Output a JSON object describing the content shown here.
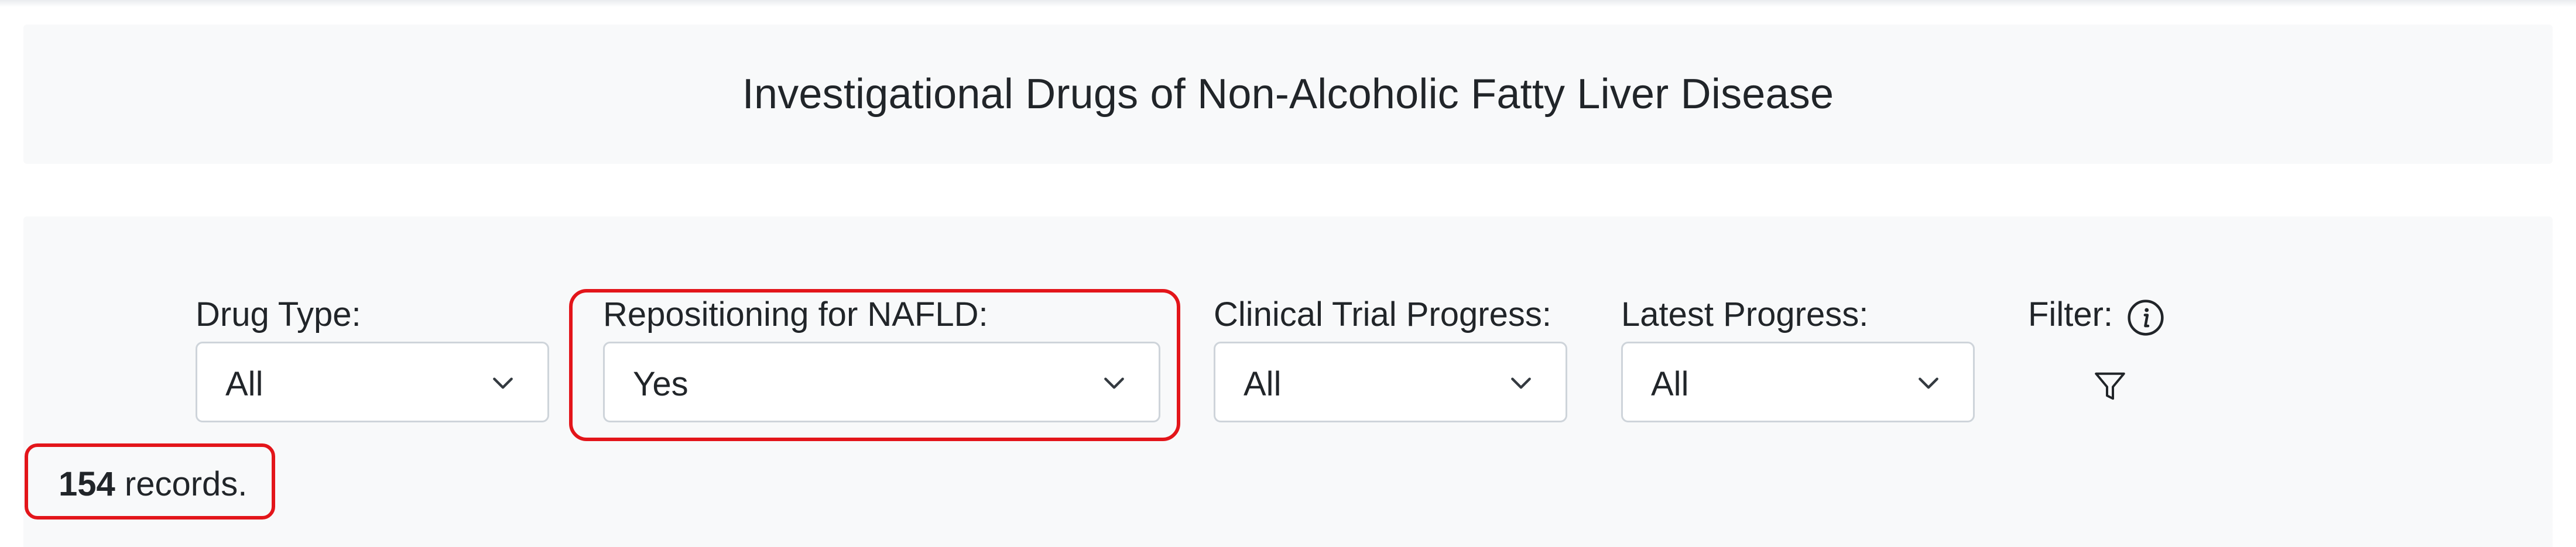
{
  "title": "Investigational Drugs of Non-Alcoholic Fatty Liver Disease",
  "filters": [
    {
      "label": "Drug Type:",
      "value": "All"
    },
    {
      "label": "Repositioning for NAFLD:",
      "value": "Yes"
    },
    {
      "label": "Clinical Trial Progress:",
      "value": "All"
    },
    {
      "label": "Latest Progress:",
      "value": "All"
    }
  ],
  "filter_control": {
    "label": "Filter:",
    "info_icon": "info-icon",
    "filter_icon": "funnel-icon"
  },
  "records": {
    "count": "154",
    "suffix": "records."
  },
  "colors": {
    "highlight": "#e3151a",
    "card_background": "#f8f9fa",
    "select_border": "#ced4da"
  }
}
